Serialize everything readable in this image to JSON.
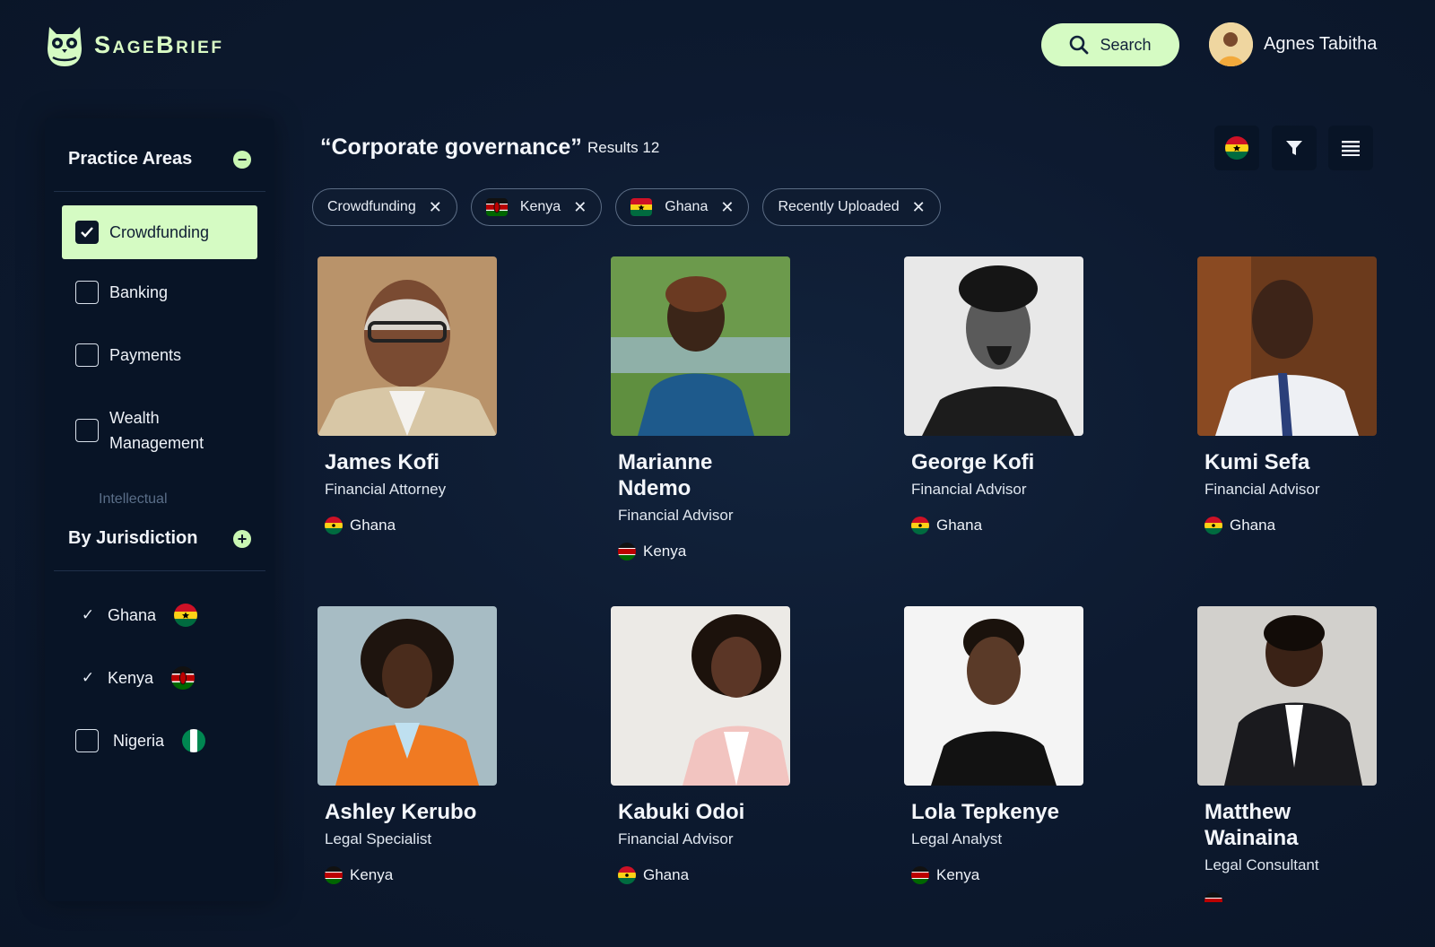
{
  "brand": {
    "name": "SageBrief",
    "logo_icon": "owl-logo-icon",
    "accent": "#d5fbc3"
  },
  "header": {
    "search_label": "Search",
    "user_name": "Agnes Tabitha"
  },
  "sidebar": {
    "practice_title": "Practice Areas",
    "practice_items": [
      {
        "label": "Crowdfunding",
        "checked": true
      },
      {
        "label": "Banking",
        "checked": false
      },
      {
        "label": "Payments",
        "checked": false
      },
      {
        "label": "Wealth Management",
        "checked": false
      },
      {
        "label": "Intellectual",
        "checked": false
      }
    ],
    "jurisdiction_title": "By Jurisdiction",
    "jurisdiction_items": [
      {
        "label": "Ghana",
        "checked": true,
        "flag": "ghana"
      },
      {
        "label": "Kenya",
        "checked": true,
        "flag": "kenya"
      },
      {
        "label": "Nigeria",
        "checked": false,
        "flag": "nigeria"
      }
    ]
  },
  "main": {
    "query": "“Corporate governance”",
    "results": "Results 12",
    "chips": [
      {
        "label": "Crowdfunding",
        "flag": null
      },
      {
        "label": "Kenya",
        "flag": "kenya"
      },
      {
        "label": "Ghana",
        "flag": "ghana"
      },
      {
        "label": "Recently Uploaded",
        "flag": null
      }
    ],
    "people": [
      {
        "name": "James Kofi",
        "role": "Financial Attorney",
        "country": "Ghana",
        "flag": "ghana"
      },
      {
        "name": "Marianne Ndemo",
        "role": "Financial Advisor",
        "country": "Kenya",
        "flag": "kenya"
      },
      {
        "name": "George Kofi",
        "role": "Financial Advisor",
        "country": "Ghana",
        "flag": "ghana"
      },
      {
        "name": "Kumi Sefa",
        "role": "Financial Advisor",
        "country": "Ghana",
        "flag": "ghana"
      },
      {
        "name": "Ashley Kerubo",
        "role": "Legal Specialist",
        "country": "Kenya",
        "flag": "kenya"
      },
      {
        "name": "Kabuki Odoi",
        "role": "Financial Advisor",
        "country": "Ghana",
        "flag": "ghana"
      },
      {
        "name": "Lola Tepkenye",
        "role": "Legal Analyst",
        "country": "Kenya",
        "flag": "kenya"
      },
      {
        "name": "Matthew Wainaina",
        "role": "Legal Consultant",
        "country": "",
        "flag": "kenya"
      }
    ]
  }
}
